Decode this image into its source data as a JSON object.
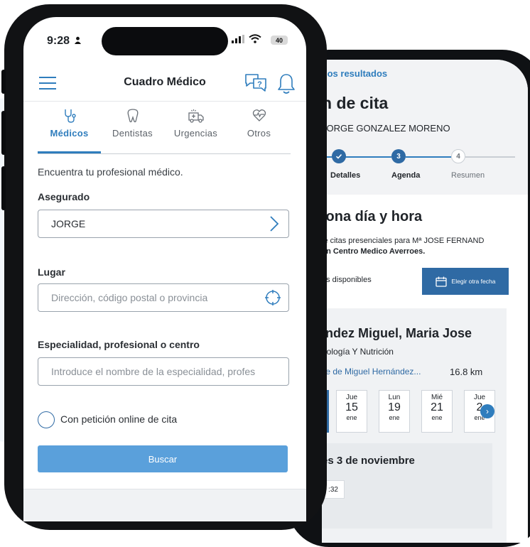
{
  "back_phone": {
    "back_link": "los resultados",
    "title": "n de cita",
    "patient": "JORGE GONZALEZ MORENO",
    "steps": [
      {
        "number": "",
        "label": "Detalles",
        "state": "done"
      },
      {
        "number": "3",
        "label": "Agenda",
        "state": "current"
      },
      {
        "number": "4",
        "label": "Resumen",
        "state": "pending"
      }
    ],
    "section_title": "iona día y hora",
    "desc_line1": "le citas presenciales para Mª JOSE FERNAND",
    "desc_line2": "en Centro Medico Averroes.",
    "available": "as disponibles",
    "other_date_button": "Elegir otra fecha",
    "doctor_name": "ındez Miguel, Maria Jose",
    "doctor_specialty": "nología Y Nutrición",
    "doctor_address": "lle de Miguel Hernández...",
    "doctor_distance": "16.8 km",
    "days": [
      {
        "weekday": "Jue",
        "day": "15",
        "month": "ene"
      },
      {
        "weekday": "Lun",
        "day": "19",
        "month": "ene"
      },
      {
        "weekday": "Mié",
        "day": "21",
        "month": "ene"
      },
      {
        "weekday": "Jue",
        "day": "2",
        "month": "ene"
      }
    ],
    "slot_day_title": "es 3 de noviembre",
    "slot_time": ":32"
  },
  "status_bar": {
    "time": "9:28",
    "battery": "40"
  },
  "header": {
    "title": "Cuadro Médico"
  },
  "tabs": [
    {
      "label": "Médicos",
      "active": true,
      "icon": "stethoscope-icon"
    },
    {
      "label": "Dentistas",
      "active": false,
      "icon": "tooth-icon"
    },
    {
      "label": "Urgencias",
      "active": false,
      "icon": "ambulance-icon"
    },
    {
      "label": "Otros",
      "active": false,
      "icon": "heart-pulse-icon"
    }
  ],
  "form": {
    "intro": "Encuentra tu profesional médico.",
    "asegurado_label": "Asegurado",
    "asegurado_value": "JORGE",
    "lugar_label": "Lugar",
    "lugar_placeholder": "Dirección, código postal o provincia",
    "especialidad_label": "Especialidad, profesional o centro",
    "especialidad_placeholder": "Introduce el nombre de la especialidad, profes",
    "online_label": "Con petición online de cita",
    "search_button": "Buscar"
  },
  "colors": {
    "accent": "#2f7dbd",
    "button": "#5aa0db",
    "dark_button": "#2f6aa4"
  }
}
